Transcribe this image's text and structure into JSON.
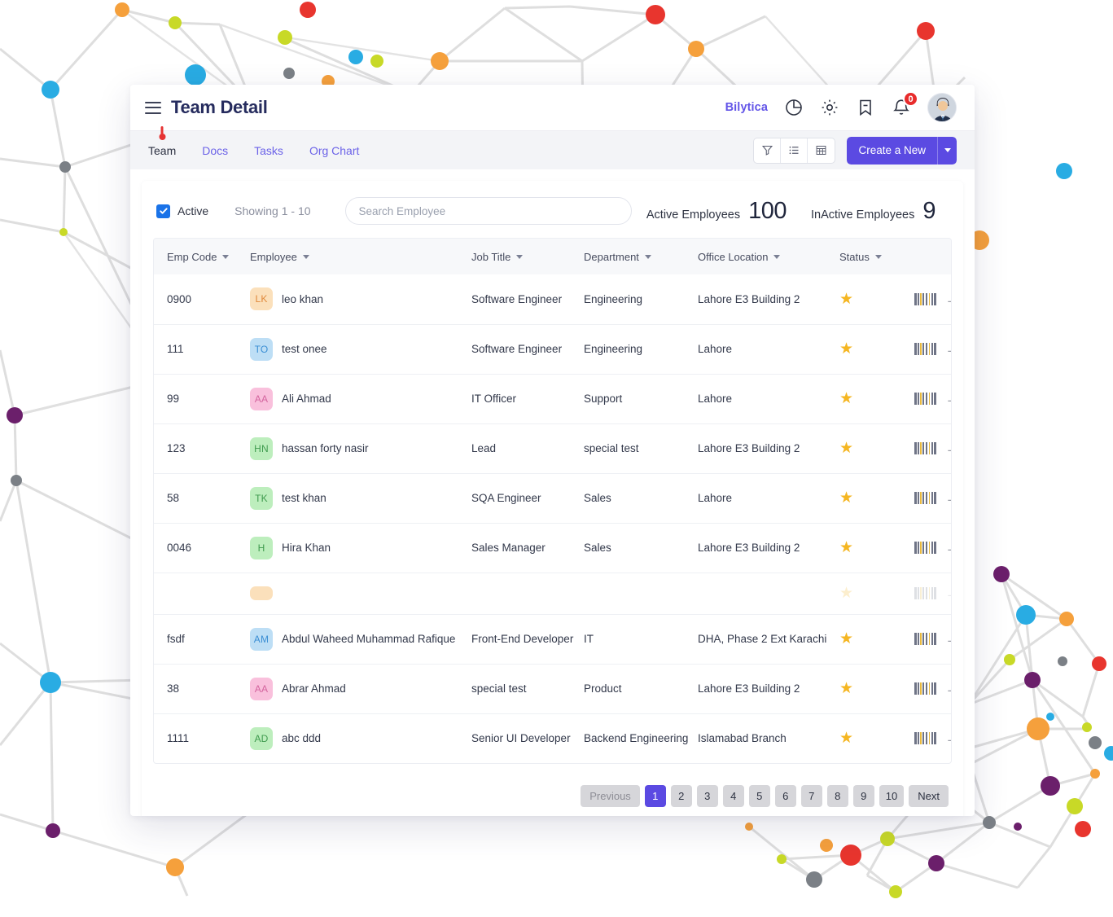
{
  "header": {
    "title": "Team Detail",
    "menu_icon": "hamburger-icon",
    "brand": "Bilytica",
    "icons": [
      "pie-chart-icon",
      "gear-icon",
      "bookmark-icon",
      "bell-icon"
    ],
    "notification_count": "0",
    "avatar": "user-avatar"
  },
  "tabs": [
    {
      "label": "Team",
      "active": true
    },
    {
      "label": "Docs",
      "active": false
    },
    {
      "label": "Tasks",
      "active": false
    },
    {
      "label": "Org Chart",
      "active": false
    }
  ],
  "toolbar": {
    "filter_icon": "funnel-icon",
    "list_icon": "list-view-icon",
    "grid_icon": "grid-view-icon",
    "create_label": "Create a New",
    "create_caret": "chevron-down-icon"
  },
  "filters": {
    "active_checkbox_label": "Active",
    "active_checked": true,
    "showing": "Showing 1 - 10",
    "search_placeholder": "Search Employee",
    "search_value": ""
  },
  "stats": {
    "active_label": "Active Employees",
    "active_value": "100",
    "inactive_label": "InActive Employees",
    "inactive_value": "9"
  },
  "table": {
    "columns": [
      "Emp Code",
      "Employee",
      "Job Title",
      "Department",
      "Office Location",
      "Status"
    ],
    "rows": [
      {
        "code": "0900",
        "initials": "LK",
        "name": "leo khan",
        "job": "Software Engineer",
        "dept": "Engineering",
        "loc": "Lahore E3 Building 2",
        "star": "★",
        "color_bg": "#fbe0bb",
        "color_fg": "#e0893b"
      },
      {
        "code": "111",
        "initials": "TO",
        "name": "test onee",
        "job": "Software Engineer",
        "dept": "Engineering",
        "loc": "Lahore",
        "star": "★",
        "color_bg": "#bddef5",
        "color_fg": "#3b8ed4"
      },
      {
        "code": "99",
        "initials": "AA",
        "name": "Ali Ahmad",
        "job": "IT Officer",
        "dept": "Support",
        "loc": "Lahore",
        "star": "★",
        "color_bg": "#f9c0dc",
        "color_fg": "#d4649e"
      },
      {
        "code": "123",
        "initials": "HN",
        "name": "hassan forty nasir",
        "job": "Lead",
        "dept": "special test",
        "loc": "Lahore E3 Building 2",
        "star": "★",
        "color_bg": "#bdeebd",
        "color_fg": "#3f9b4e"
      },
      {
        "code": "58",
        "initials": "TK",
        "name": "test khan",
        "job": "SQA Engineer",
        "dept": "Sales",
        "loc": "Lahore",
        "star": "★",
        "color_bg": "#bdeebd",
        "color_fg": "#3f9b4e"
      },
      {
        "code": "0046",
        "initials": "H",
        "name": "Hira Khan",
        "job": "Sales Manager",
        "dept": "Sales",
        "loc": "Lahore E3 Building 2",
        "star": "★",
        "color_bg": "#bdeebd",
        "color_fg": "#3f9b4e"
      },
      {
        "code": "",
        "initials": "",
        "name": "",
        "job": "",
        "dept": "",
        "loc": "",
        "star": "",
        "color_bg": "#fbe0bb",
        "color_fg": "#e0893b",
        "partial": true
      },
      {
        "code": "fsdf",
        "initials": "AM",
        "name": "Abdul Waheed Muhammad Rafique",
        "job": "Front-End Developer",
        "dept": "IT",
        "loc": "DHA, Phase 2 Ext Karachi",
        "star": "★",
        "color_bg": "#bddef5",
        "color_fg": "#3b8ed4"
      },
      {
        "code": "38",
        "initials": "AA",
        "name": "Abrar Ahmad",
        "job": "special test",
        "dept": "Product",
        "loc": "Lahore E3 Building 2",
        "star": "★",
        "color_bg": "#f9c0dc",
        "color_fg": "#d4649e"
      },
      {
        "code": "1111",
        "initials": "AD",
        "name": "abc ddd",
        "job": "Senior UI Developer",
        "dept": "Backend Engineering",
        "loc": "Islamabad Branch",
        "star": "★",
        "color_bg": "#bdeebd",
        "color_fg": "#3f9b4e"
      }
    ],
    "action_icons": [
      "barcode-icon",
      "arrow-right-icon"
    ]
  },
  "pagination": {
    "previous": "Previous",
    "pages": [
      "1",
      "2",
      "3",
      "4",
      "5",
      "6",
      "7",
      "8",
      "9",
      "10"
    ],
    "active_page": "1",
    "next": "Next"
  },
  "colors": {
    "accent_purple": "#5b4ae2",
    "title_navy": "#262c5e",
    "link_purple": "#6c63e8",
    "badge_red": "#e82c2c",
    "star_gold": "#f5b622",
    "checkbox_blue": "#1a73e8"
  },
  "background": {
    "graphic": "network-node-graph",
    "node_colors": [
      "#29ace3",
      "#f5a03c",
      "#e8352e",
      "#c8d927",
      "#6b1f6b",
      "#7b8086"
    ]
  }
}
